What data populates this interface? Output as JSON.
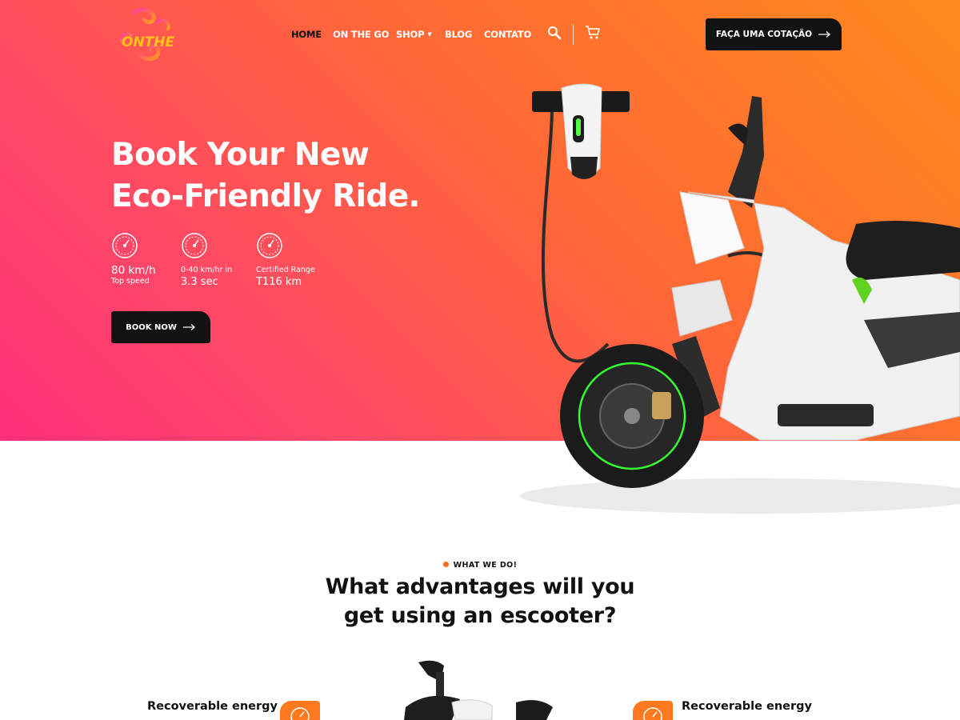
{
  "brand": {
    "logo_text": "ONTHEGO",
    "primary": "#ff6a34",
    "accent_dark": "#121212",
    "gradient": [
      "#ff8a1c",
      "#ff2f7a"
    ]
  },
  "nav": {
    "items": [
      {
        "label": "HOME",
        "active": true
      },
      {
        "label": "ON THE GO",
        "active": false
      },
      {
        "label": "SHOP",
        "active": false,
        "has_dropdown": true
      },
      {
        "label": "BLOG",
        "active": false
      },
      {
        "label": "CONTATO",
        "active": false
      }
    ],
    "search_icon": "search-icon",
    "cart_icon": "cart-icon",
    "cta_label": "FAÇA UMA COTAÇÃO"
  },
  "hero": {
    "title_line1": "Book Your New",
    "title_line2": "Eco-Friendly Ride.",
    "stats": [
      {
        "icon": "speedometer-icon",
        "value": "80 km/h",
        "caption": "Top speed"
      },
      {
        "icon": "speedometer-icon",
        "caption": "0-40 km/hr in",
        "value": "3.3 sec"
      },
      {
        "icon": "speedometer-icon",
        "caption": "Certified Range",
        "value": "T116 km"
      }
    ],
    "cta_label": "BOOK NOW"
  },
  "section": {
    "eyebrow": "WHAT WE DO!",
    "title_line1": "What advantages will you",
    "title_line2": "get using an escooter?"
  },
  "features": [
    {
      "label": "Recoverable energy",
      "icon": "speedometer-icon"
    },
    {
      "label": "Recoverable energy",
      "icon": "speedometer-icon"
    }
  ]
}
